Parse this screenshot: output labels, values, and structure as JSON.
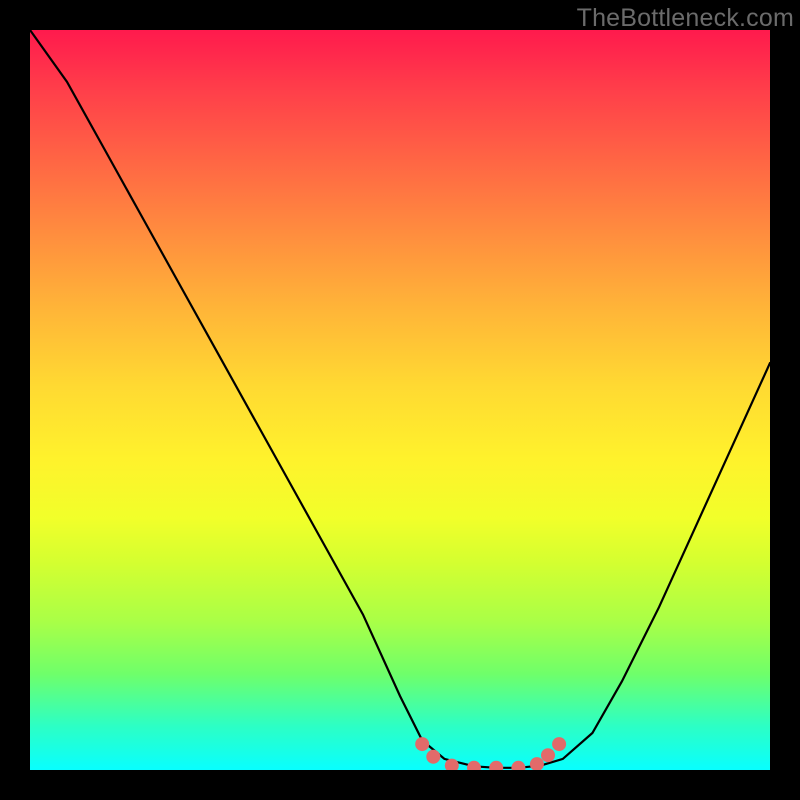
{
  "watermark": "TheBottleneck.com",
  "chart_data": {
    "type": "line",
    "title": "",
    "xlabel": "",
    "ylabel": "",
    "xlim": [
      0,
      1
    ],
    "ylim": [
      0,
      1
    ],
    "annotations": [],
    "note": "Axes are unlabeled; x and y are normalized 0–1. The plotted value appears to represent a bottleneck/mismatch metric (high = red, low = green) as a function of some hardware parameter. Curve reaches ~0 around x≈0.53–0.70 and rises sharply on both sides. A cluster of salmon-colored marker dots sits on the minimum region.",
    "series": [
      {
        "name": "mismatch-curve",
        "color": "#000000",
        "x": [
          0.0,
          0.05,
          0.1,
          0.15,
          0.2,
          0.25,
          0.3,
          0.35,
          0.4,
          0.45,
          0.5,
          0.53,
          0.56,
          0.6,
          0.63,
          0.66,
          0.69,
          0.72,
          0.76,
          0.8,
          0.85,
          0.9,
          0.95,
          1.0
        ],
        "y": [
          1.0,
          0.93,
          0.84,
          0.75,
          0.66,
          0.57,
          0.48,
          0.39,
          0.3,
          0.21,
          0.1,
          0.04,
          0.015,
          0.005,
          0.003,
          0.003,
          0.006,
          0.015,
          0.05,
          0.12,
          0.22,
          0.33,
          0.44,
          0.55
        ]
      }
    ],
    "markers": {
      "name": "optimal-range-dots",
      "color": "#e26a6a",
      "points": [
        {
          "x": 0.53,
          "y": 0.035
        },
        {
          "x": 0.545,
          "y": 0.018
        },
        {
          "x": 0.57,
          "y": 0.006
        },
        {
          "x": 0.6,
          "y": 0.003
        },
        {
          "x": 0.63,
          "y": 0.003
        },
        {
          "x": 0.66,
          "y": 0.003
        },
        {
          "x": 0.685,
          "y": 0.008
        },
        {
          "x": 0.7,
          "y": 0.02
        },
        {
          "x": 0.715,
          "y": 0.035
        }
      ]
    },
    "gradient_stops": [
      {
        "pos": 0.0,
        "color": "#ff1a4d"
      },
      {
        "pos": 0.5,
        "color": "#fff22c"
      },
      {
        "pos": 1.0,
        "color": "#08ffff"
      }
    ]
  }
}
